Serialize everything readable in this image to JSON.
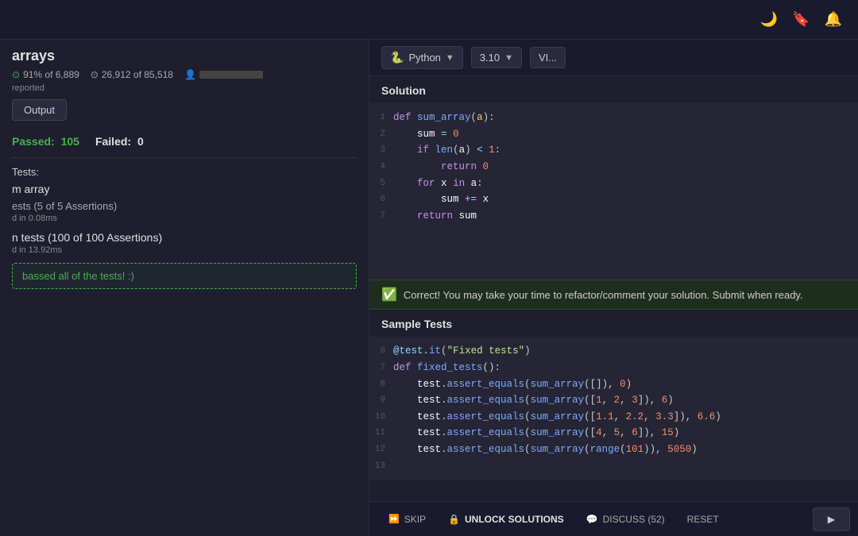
{
  "header": {
    "moon_icon": "🌙",
    "bookmark_icon": "🔖",
    "bell_icon": "🔔"
  },
  "kata": {
    "title": "arrays",
    "completion_pct": "91% of 6,889",
    "solutions_count": "26,912 of 85,518",
    "reported_label": "reported"
  },
  "output_tab": {
    "label": "Output"
  },
  "results": {
    "passed_label": "Passed:",
    "passed_count": "105",
    "failed_label": "Failed:",
    "failed_count": "0",
    "tests_section_label": "Tests:",
    "test_group_1_label": "m array",
    "test_item_1_label": "ests (5 of 5 Assertions)",
    "test_time_1": "d in 0.08ms",
    "test_group_2_label": "n tests (100 of 100 Assertions)",
    "test_time_2": "d in 13.92ms",
    "success_message": "bassed all of the tests! :)"
  },
  "toolbar": {
    "language_label": "Python",
    "version_label": "3.10",
    "vim_label": "VI..."
  },
  "solution_section": {
    "title": "Solution",
    "lines": [
      {
        "num": "1",
        "content": "def sum_array(a):"
      },
      {
        "num": "2",
        "content": "    sum = 0"
      },
      {
        "num": "3",
        "content": "    if len(a) < 1:"
      },
      {
        "num": "4",
        "content": "        return 0"
      },
      {
        "num": "5",
        "content": "    for x in a:"
      },
      {
        "num": "6",
        "content": "        sum += x"
      },
      {
        "num": "7",
        "content": "    return sum"
      }
    ]
  },
  "correct_banner": {
    "text": "Correct! You may take your time to refactor/comment your solution. Submit when ready."
  },
  "sample_section": {
    "title": "Sample Tests",
    "lines": [
      {
        "num": "6",
        "content": "@test.it(\"Fixed tests\")"
      },
      {
        "num": "7",
        "content": "def fixed_tests():"
      },
      {
        "num": "8",
        "content": "    test.assert_equals(sum_array([]), 0)"
      },
      {
        "num": "9",
        "content": "    test.assert_equals(sum_array([1, 2, 3]), 6)"
      },
      {
        "num": "10",
        "content": "    test.assert_equals(sum_array([1.1, 2.2, 3.3]), 6.6)"
      },
      {
        "num": "11",
        "content": "    test.assert_equals(sum_array([4, 5, 6]), 15)"
      },
      {
        "num": "12",
        "content": "    test.assert_equals(sum_array(range(101)), 5050)"
      },
      {
        "num": "13",
        "content": ""
      }
    ]
  },
  "bottom_bar": {
    "skip_label": "SKIP",
    "unlock_label": "UNLOCK SOLUTIONS",
    "discuss_label": "DISCUSS (52)",
    "reset_label": "RESET"
  }
}
